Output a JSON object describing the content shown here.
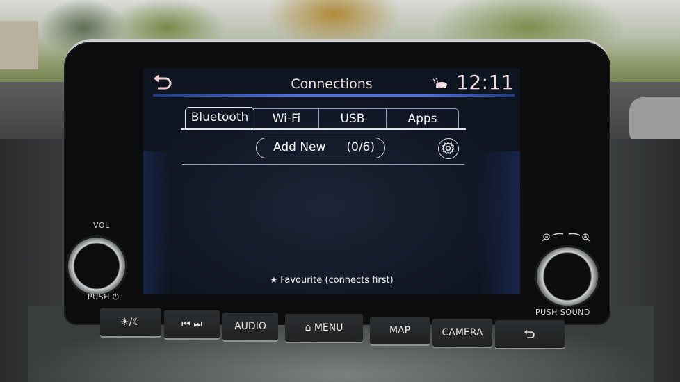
{
  "screen": {
    "header": {
      "back_icon": "back-arrow-icon",
      "title": "Connections",
      "status_icon": "car-connected-icon",
      "clock": "12:11"
    },
    "tabs": [
      {
        "label": "Bluetooth",
        "active": true
      },
      {
        "label": "Wi-Fi",
        "active": false
      },
      {
        "label": "USB",
        "active": false
      },
      {
        "label": "Apps",
        "active": false
      }
    ],
    "add_new": {
      "label": "Add New",
      "count": "(0/6)"
    },
    "settings_icon": "gear-icon",
    "footer_note": {
      "icon": "star-icon",
      "text": "Favourite (connects first)"
    }
  },
  "knobs": {
    "left": {
      "top_label": "VOL",
      "bottom_label": "PUSH",
      "bottom_icon": "power-icon"
    },
    "right": {
      "top_icons": [
        "zoom-out-icon",
        "zoom-in-icon"
      ],
      "bottom_label": "PUSH SOUND"
    }
  },
  "hardware_buttons": [
    {
      "id": "day-night",
      "label": "☀/☾",
      "icon": "day-night-icon"
    },
    {
      "id": "track",
      "label": "⏮  ⏭",
      "icon": "prev-next-icon"
    },
    {
      "id": "audio",
      "label": "AUDIO"
    },
    {
      "id": "menu",
      "label": "MENU",
      "icon": "home-icon"
    },
    {
      "id": "map",
      "label": "MAP"
    },
    {
      "id": "camera",
      "label": "CAMERA"
    },
    {
      "id": "back",
      "label": "",
      "icon": "back-arrow-icon"
    }
  ],
  "colors": {
    "accent_line": "#4d72e0",
    "title_text": "#f1dfe2",
    "screen_bg": "#131a28"
  }
}
